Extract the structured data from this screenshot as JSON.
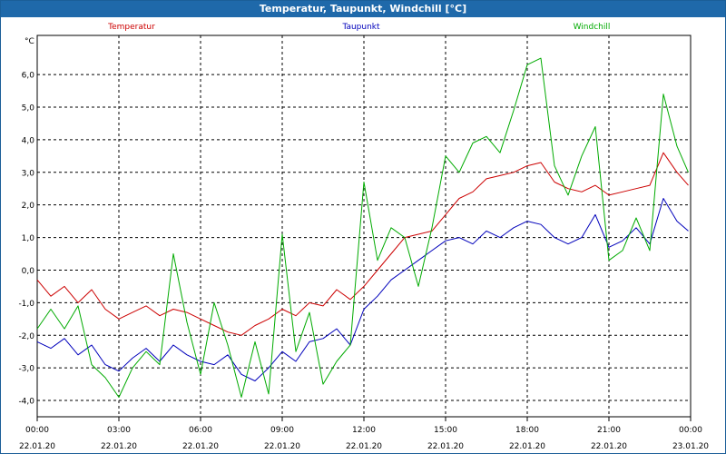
{
  "window": {
    "title": "Temperatur, Taupunkt, Windchill [°C]"
  },
  "chart_data": {
    "type": "line",
    "title": "Temperatur, Taupunkt, Windchill [°C]",
    "ylabel": "°C",
    "ylim": [
      -4.5,
      7.2
    ],
    "yticks": [
      -4.0,
      -3.0,
      -2.0,
      -1.0,
      0.0,
      1.0,
      2.0,
      3.0,
      4.0,
      5.0,
      6.0
    ],
    "ytick_labels": [
      "-4,0",
      "-3,0",
      "-2,0",
      "-1,0",
      "0,0",
      "1,0",
      "2,0",
      "3,0",
      "4,0",
      "5,0",
      "6,0"
    ],
    "xlim": [
      "22.01.20 00:00",
      "23.01.20 00:00"
    ],
    "xticks": [
      {
        "time": "00:00",
        "date": "22.01.20"
      },
      {
        "time": "03:00",
        "date": "22.01.20"
      },
      {
        "time": "06:00",
        "date": "22.01.20"
      },
      {
        "time": "09:00",
        "date": "22.01.20"
      },
      {
        "time": "12:00",
        "date": "22.01.20"
      },
      {
        "time": "15:00",
        "date": "22.01.20"
      },
      {
        "time": "18:00",
        "date": "22.01.20"
      },
      {
        "time": "21:00",
        "date": "22.01.20"
      },
      {
        "time": "00:00",
        "date": "23.01.20"
      }
    ],
    "grid": true,
    "legend_placement": "top",
    "series": [
      {
        "name": "Temperatur",
        "color": "#cc0000",
        "x": [
          "22.01.20 00:00",
          "22.01.20 00:30",
          "22.01.20 01:00",
          "22.01.20 01:30",
          "22.01.20 02:00",
          "22.01.20 02:30",
          "22.01.20 03:00",
          "22.01.20 03:30",
          "22.01.20 04:00",
          "22.01.20 04:30",
          "22.01.20 05:00",
          "22.01.20 05:30",
          "22.01.20 06:00",
          "22.01.20 06:30",
          "22.01.20 07:00",
          "22.01.20 07:30",
          "22.01.20 08:00",
          "22.01.20 08:30",
          "22.01.20 09:00",
          "22.01.20 09:30",
          "22.01.20 10:00",
          "22.01.20 10:30",
          "22.01.20 11:00",
          "22.01.20 11:30",
          "22.01.20 12:00",
          "22.01.20 12:30",
          "22.01.20 13:00",
          "22.01.20 13:30",
          "22.01.20 14:00",
          "22.01.20 14:30",
          "22.01.20 15:00",
          "22.01.20 15:30",
          "22.01.20 16:00",
          "22.01.20 16:30",
          "22.01.20 17:00",
          "22.01.20 17:30",
          "22.01.20 18:00",
          "22.01.20 18:30",
          "22.01.20 19:00",
          "22.01.20 19:30",
          "22.01.20 20:00",
          "22.01.20 20:30",
          "22.01.20 21:00",
          "22.01.20 21:30",
          "22.01.20 22:00",
          "22.01.20 22:30",
          "22.01.20 23:00",
          "22.01.20 23:30",
          "22.01.20 23:55"
        ],
        "y": [
          -0.3,
          -0.8,
          -0.5,
          -1.0,
          -0.6,
          -1.2,
          -1.5,
          -1.3,
          -1.1,
          -1.4,
          -1.2,
          -1.3,
          -1.5,
          -1.7,
          -1.9,
          -2.0,
          -1.7,
          -1.5,
          -1.2,
          -1.4,
          -1.0,
          -1.1,
          -0.6,
          -0.9,
          -0.5,
          0.0,
          0.5,
          1.0,
          1.1,
          1.2,
          1.7,
          2.2,
          2.4,
          2.8,
          2.9,
          3.0,
          3.2,
          3.3,
          2.7,
          2.5,
          2.4,
          2.6,
          2.3,
          2.4,
          2.5,
          2.6,
          3.6,
          3.0,
          2.6
        ]
      },
      {
        "name": "Taupunkt",
        "color": "#0000bb",
        "x": [
          "22.01.20 00:00",
          "22.01.20 00:30",
          "22.01.20 01:00",
          "22.01.20 01:30",
          "22.01.20 02:00",
          "22.01.20 02:30",
          "22.01.20 03:00",
          "22.01.20 03:30",
          "22.01.20 04:00",
          "22.01.20 04:30",
          "22.01.20 05:00",
          "22.01.20 05:30",
          "22.01.20 06:00",
          "22.01.20 06:30",
          "22.01.20 07:00",
          "22.01.20 07:30",
          "22.01.20 08:00",
          "22.01.20 08:30",
          "22.01.20 09:00",
          "22.01.20 09:30",
          "22.01.20 10:00",
          "22.01.20 10:30",
          "22.01.20 11:00",
          "22.01.20 11:30",
          "22.01.20 12:00",
          "22.01.20 12:30",
          "22.01.20 13:00",
          "22.01.20 13:30",
          "22.01.20 14:00",
          "22.01.20 14:30",
          "22.01.20 15:00",
          "22.01.20 15:30",
          "22.01.20 16:00",
          "22.01.20 16:30",
          "22.01.20 17:00",
          "22.01.20 17:30",
          "22.01.20 18:00",
          "22.01.20 18:30",
          "22.01.20 19:00",
          "22.01.20 19:30",
          "22.01.20 20:00",
          "22.01.20 20:30",
          "22.01.20 21:00",
          "22.01.20 21:30",
          "22.01.20 22:00",
          "22.01.20 22:30",
          "22.01.20 23:00",
          "22.01.20 23:30",
          "22.01.20 23:55"
        ],
        "y": [
          -2.2,
          -2.4,
          -2.1,
          -2.6,
          -2.3,
          -2.9,
          -3.1,
          -2.7,
          -2.4,
          -2.8,
          -2.3,
          -2.6,
          -2.8,
          -2.9,
          -2.6,
          -3.2,
          -3.4,
          -3.0,
          -2.5,
          -2.8,
          -2.2,
          -2.1,
          -1.8,
          -2.3,
          -1.2,
          -0.8,
          -0.3,
          0.0,
          0.3,
          0.6,
          0.9,
          1.0,
          0.8,
          1.2,
          1.0,
          1.3,
          1.5,
          1.4,
          1.0,
          0.8,
          1.0,
          1.7,
          0.7,
          0.9,
          1.3,
          0.8,
          2.2,
          1.5,
          1.2
        ]
      },
      {
        "name": "Windchill",
        "color": "#00aa00",
        "x": [
          "22.01.20 00:00",
          "22.01.20 00:30",
          "22.01.20 01:00",
          "22.01.20 01:30",
          "22.01.20 02:00",
          "22.01.20 02:30",
          "22.01.20 03:00",
          "22.01.20 03:30",
          "22.01.20 04:00",
          "22.01.20 04:30",
          "22.01.20 05:00",
          "22.01.20 05:30",
          "22.01.20 06:00",
          "22.01.20 06:30",
          "22.01.20 07:00",
          "22.01.20 07:30",
          "22.01.20 08:00",
          "22.01.20 08:30",
          "22.01.20 09:00",
          "22.01.20 09:30",
          "22.01.20 10:00",
          "22.01.20 10:30",
          "22.01.20 11:00",
          "22.01.20 11:30",
          "22.01.20 12:00",
          "22.01.20 12:30",
          "22.01.20 13:00",
          "22.01.20 13:30",
          "22.01.20 14:00",
          "22.01.20 14:30",
          "22.01.20 15:00",
          "22.01.20 15:30",
          "22.01.20 16:00",
          "22.01.20 16:30",
          "22.01.20 17:00",
          "22.01.20 17:30",
          "22.01.20 18:00",
          "22.01.20 18:30",
          "22.01.20 19:00",
          "22.01.20 19:30",
          "22.01.20 20:00",
          "22.01.20 20:30",
          "22.01.20 21:00",
          "22.01.20 21:30",
          "22.01.20 22:00",
          "22.01.20 22:30",
          "22.01.20 23:00",
          "22.01.20 23:30",
          "22.01.20 23:55"
        ],
        "y": [
          -1.8,
          -1.2,
          -1.8,
          -1.1,
          -2.9,
          -3.3,
          -3.9,
          -3.0,
          -2.5,
          -2.9,
          0.5,
          -1.6,
          -3.2,
          -1.0,
          -2.3,
          -3.9,
          -2.2,
          -3.8,
          1.1,
          -2.5,
          -1.3,
          -3.5,
          -2.8,
          -2.3,
          2.7,
          0.3,
          1.3,
          1.0,
          -0.5,
          1.3,
          3.5,
          3.0,
          3.9,
          4.1,
          3.6,
          4.9,
          6.3,
          6.5,
          3.2,
          2.3,
          3.5,
          4.4,
          0.3,
          0.6,
          1.6,
          0.6,
          5.4,
          3.8,
          3.0
        ]
      }
    ]
  }
}
